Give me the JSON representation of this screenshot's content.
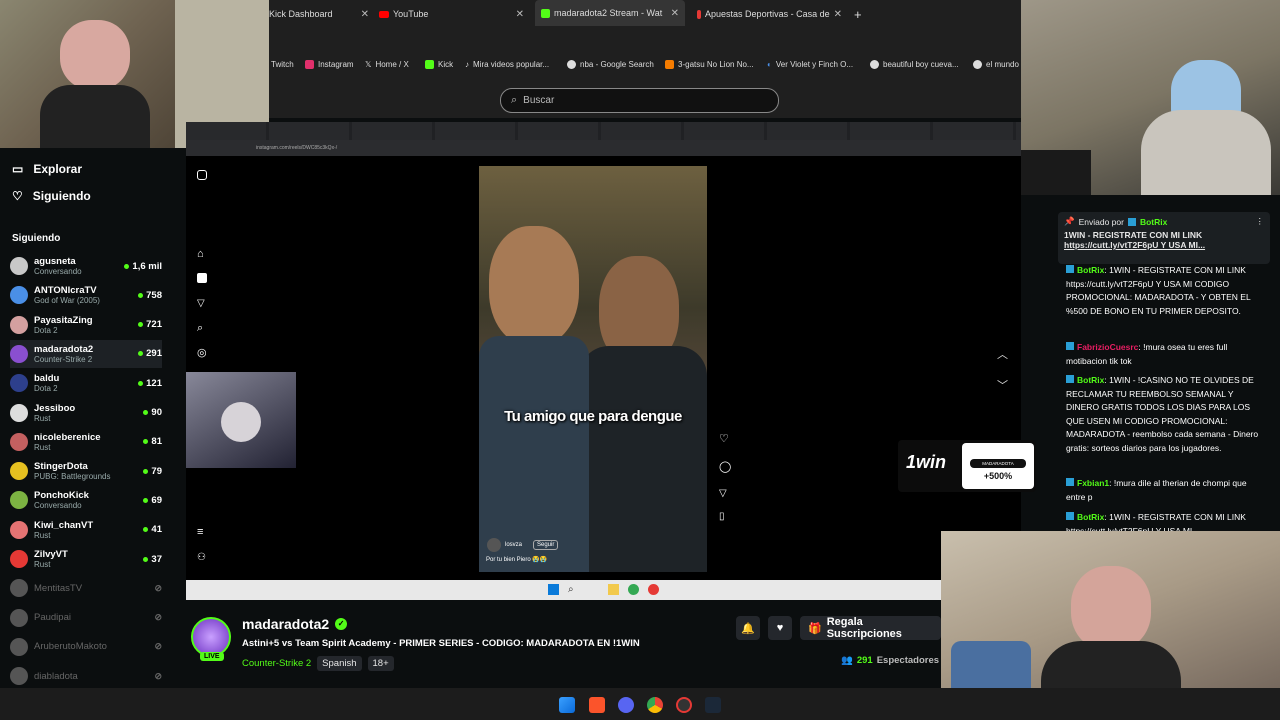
{
  "browser": {
    "tabs": [
      {
        "label": "Kick Dashboard",
        "active": false
      },
      {
        "label": "YouTube",
        "active": false
      },
      {
        "label": "madaradota2 Stream - Wat",
        "active": true
      },
      {
        "label": "Apuestas Deportivas - Casa de",
        "active": false
      }
    ],
    "bookmarks": [
      "Twitch",
      "Instagram",
      "Home / X",
      "Kick",
      "Mira videos popular...",
      "nba - Google Search",
      "3-gatsu No Lion No...",
      "Ver Violet y Finch O...",
      "beautiful boy cueva...",
      "el mundo"
    ],
    "search_placeholder": "Buscar"
  },
  "sidebar": {
    "nav": [
      {
        "label": "Explorar",
        "icon": "browse-icon"
      },
      {
        "label": "Siguiendo",
        "icon": "heart-icon"
      }
    ],
    "section_label": "Siguiendo",
    "channels": [
      {
        "name": "agusneta",
        "game": "Conversando",
        "viewers": "1,6 mil",
        "color": "#c8c8c8",
        "live": true
      },
      {
        "name": "ANTONIcraTV",
        "game": "God of War (2005)",
        "viewers": "758",
        "color": "#4a8fe7",
        "live": true
      },
      {
        "name": "PayasitaZing",
        "game": "Dota 2",
        "viewers": "721",
        "color": "#d4a0a0",
        "live": true
      },
      {
        "name": "madaradota2",
        "game": "Counter-Strike 2",
        "viewers": "291",
        "color": "#8a4fd0",
        "live": true
      },
      {
        "name": "baldu",
        "game": "Dota 2",
        "viewers": "121",
        "color": "#2d3f8c",
        "live": true
      },
      {
        "name": "Jessiboo",
        "game": "Rust",
        "viewers": "90",
        "color": "#ddd",
        "live": true
      },
      {
        "name": "nicoleberenice",
        "game": "Rust",
        "viewers": "81",
        "color": "#c46060",
        "live": true
      },
      {
        "name": "StingerDota",
        "game": "PUBG: Battlegrounds",
        "viewers": "79",
        "color": "#e6c020",
        "live": true
      },
      {
        "name": "PonchoKick",
        "game": "Conversando",
        "viewers": "69",
        "color": "#7cb342",
        "live": true
      },
      {
        "name": "Kiwi_chanVT",
        "game": "Rust",
        "viewers": "41",
        "color": "#e57373",
        "live": true
      },
      {
        "name": "ZilvyVT",
        "game": "Rust",
        "viewers": "37",
        "color": "#e53935",
        "live": true
      },
      {
        "name": "MentitasTV",
        "game": "",
        "viewers": "",
        "color": "#555",
        "live": false
      },
      {
        "name": "Paudipai",
        "game": "",
        "viewers": "",
        "color": "#555",
        "live": false
      },
      {
        "name": "AruberutoMakoto",
        "game": "",
        "viewers": "",
        "color": "#555",
        "live": false
      },
      {
        "name": "diabladota",
        "game": "",
        "viewers": "",
        "color": "#555",
        "live": false
      }
    ]
  },
  "stream": {
    "reel_caption": "Tu amigo que para dengue",
    "reel_user": "losvza",
    "reel_follow": "Seguir",
    "reel_desc": "Por tu bien Piero 😭😭",
    "url": "instagram.com/reels/DWC85c3kQx-/",
    "ad_brand": "1win",
    "ad_badge": "+500%",
    "ad_label": "MADARADOTA"
  },
  "channel_info": {
    "name": "madaradota2",
    "live_badge": "LIVE",
    "title": "Astini+5 vs Team Spirit Academy - PRIMER SERIES - CODIGO: MADARADOTA EN !1WIN",
    "category": "Counter-Strike 2",
    "tags": [
      "Spanish",
      "18+"
    ],
    "gift_button": "Regala Suscripciones",
    "viewers": "291",
    "viewers_label": "Espectadores"
  },
  "chat": {
    "pinned_by_label": "Enviado por",
    "pinned_by_user": "BotRix",
    "pinned_text": "1WIN - REGISTRATE CON MI LINK",
    "pinned_link": "https://cutt.ly/vtT2F6pU Y USA MI...",
    "messages": [
      {
        "user": "BotRix",
        "color": "#53fc18",
        "text": ": 1WIN - REGISTRATE CON MI LINK https://cutt.ly/vtT2F6pU Y USA MI CODIGO PROMOCIONAL: MADARADOTA - Y OBTEN EL %500 DE BONO EN TU PRIMER DEPOSITO."
      },
      {
        "user": "FabrizioCuesrc",
        "color": "#e91e63",
        "text": ": !mura osea tu eres full motibacion tik tok"
      },
      {
        "user": "BotRix",
        "color": "#53fc18",
        "text": ": 1WIN - !CASINO NO TE OLVIDES DE RECLAMAR TU REEMBOLSO SEMANAL Y DINERO GRATIS TODOS LOS DIAS PARA LOS QUE USEN MI CODIGO PROMOCIONAL: MADARADOTA - reembolso cada semana - Dinero gratis: sorteos diarios para los jugadores."
      },
      {
        "user": "Fxbian1",
        "color": "#53fc18",
        "text": ": !mura dile al therian de chompi que entre p"
      },
      {
        "user": "BotRix",
        "color": "#53fc18",
        "text": ": 1WIN - REGISTRATE CON MI LINK https://cutt.ly/vtT2F6pU Y USA MI..."
      }
    ]
  },
  "colors": {
    "kick_green": "#53fc18",
    "bg": "#0b0e0f"
  }
}
